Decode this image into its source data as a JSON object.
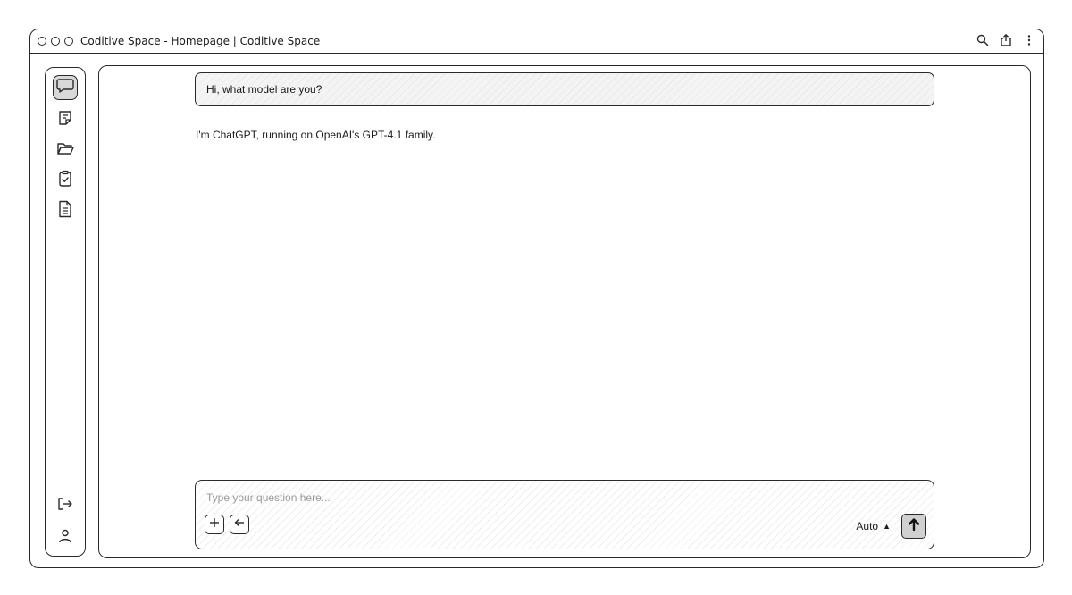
{
  "window": {
    "title": "Coditive Space - Homepage | Coditive Space"
  },
  "titlebar_icons": [
    "search-icon",
    "share-icon",
    "more-vertical-icon"
  ],
  "sidebar": {
    "items": [
      {
        "name": "chat",
        "icon": "chat-bubble-icon",
        "active": true
      },
      {
        "name": "notes",
        "icon": "note-icon",
        "active": false
      },
      {
        "name": "folders",
        "icon": "folder-icon",
        "active": false
      },
      {
        "name": "tasks",
        "icon": "clipboard-check-icon",
        "active": false
      },
      {
        "name": "documents",
        "icon": "document-icon",
        "active": false
      }
    ],
    "bottom": [
      {
        "name": "logout",
        "icon": "logout-icon"
      },
      {
        "name": "profile",
        "icon": "user-icon"
      }
    ]
  },
  "conversation": {
    "user_message": "Hi, what model are you?",
    "assistant_message": "I'm ChatGPT, running on OpenAI's GPT-4.1 family."
  },
  "composer": {
    "placeholder": "Type your question here...",
    "value": "",
    "model_label": "Auto",
    "model_caret": "▲"
  },
  "colors": {
    "active_fill": "#d9d9d9",
    "send_fill": "#d0d0d0",
    "stroke": "#2a2a2a"
  }
}
